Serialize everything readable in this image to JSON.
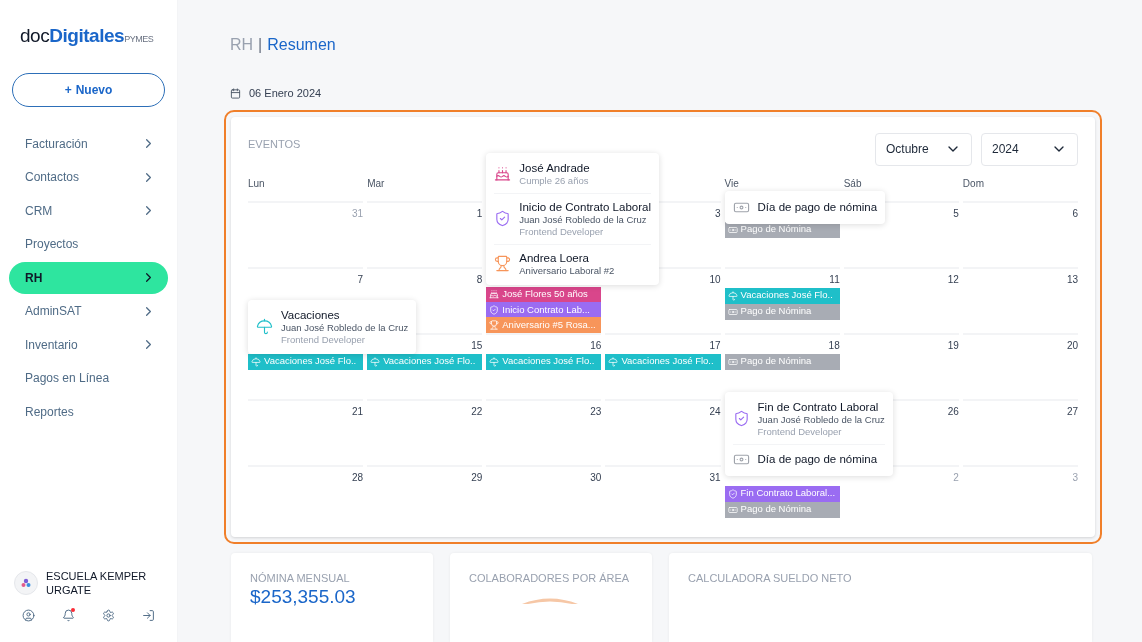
{
  "sidebar": {
    "logo": {
      "prefix": "doc",
      "name": "Digitales",
      "suffix": "PYMES"
    },
    "new_button": {
      "icon": "+",
      "label": "Nuevo"
    },
    "items": [
      {
        "label": "Facturación",
        "expandable": true,
        "selected": false
      },
      {
        "label": "Contactos",
        "expandable": true,
        "selected": false
      },
      {
        "label": "CRM",
        "expandable": true,
        "selected": false
      },
      {
        "label": "Proyectos",
        "expandable": false,
        "selected": false
      },
      {
        "label": "RH",
        "expandable": true,
        "selected": true
      },
      {
        "label": "AdminSAT",
        "expandable": true,
        "selected": false
      },
      {
        "label": "Inventario",
        "expandable": true,
        "selected": false
      },
      {
        "label": "Pagos en Línea",
        "expandable": false,
        "selected": false
      },
      {
        "label": "Reportes",
        "expandable": false,
        "selected": false
      }
    ],
    "company": {
      "name": "ESCUELA KEMPER URGATE"
    },
    "footer_icons": [
      {
        "kind": "user"
      },
      {
        "kind": "bell",
        "unread": true
      },
      {
        "kind": "settings"
      },
      {
        "kind": "logout"
      }
    ]
  },
  "breadcrumb": {
    "section": "RH",
    "separator": "|",
    "page": "Resumen"
  },
  "date": "06 Enero 2024",
  "events_card": {
    "title": "EVENTOS",
    "month_select": "Octubre",
    "year_select": "2024",
    "weekdays": [
      {
        "kind": "mon",
        "label": "Lun"
      },
      {
        "kind": "tue",
        "label": "Mar"
      },
      {
        "kind": "fri",
        "label": "Vie"
      },
      {
        "kind": "sat",
        "label": "Sáb"
      },
      {
        "kind": "sun",
        "label": "Dom"
      }
    ],
    "weeks": [
      [
        {
          "date": "31",
          "outside": true
        },
        {
          "date": "1",
          "outside": false
        },
        {
          "popover": [
            {
              "kind": "birthday",
              "title": "José Andrade",
              "detail": "Cumple 26 años"
            },
            {
              "kind": "contract",
              "title": "Inicio de Contrato Laboral",
              "subtitle": "Juan José Robledo de la Cruz",
              "detail": "Frontend Developer"
            },
            {
              "kind": "anniversary",
              "title": "Andrea Loera",
              "subtitle": "Aniversario Laboral #2"
            }
          ]
        },
        {
          "date": "3",
          "outside": false
        },
        {
          "events": [
            {
              "kind": "payroll",
              "label": "Pago de Nómina"
            }
          ],
          "popover": [
            {
              "kind": "payroll",
              "title": "Día de pago de nómina"
            }
          ]
        },
        {
          "date": "5",
          "outside": false
        },
        {
          "date": "6",
          "outside": false
        }
      ],
      [
        {
          "date": "7",
          "outside": false
        },
        {
          "date": "8",
          "outside": false
        },
        {
          "events": [
            {
              "kind": "birthday",
              "label": "José Flores 50 años"
            },
            {
              "kind": "contract",
              "label": "Inicio Contrato Lab..."
            },
            {
              "kind": "anniversary",
              "label": "Aniversario #5 Rosa..."
            }
          ]
        },
        {
          "date": "10",
          "outside": false
        },
        {
          "date": "11",
          "outside": false,
          "events": [
            {
              "kind": "vacation",
              "label": "Vacaciones José Flo.."
            },
            {
              "kind": "payroll",
              "label": "Pago de Nómina"
            }
          ]
        },
        {
          "date": "12",
          "outside": false
        },
        {
          "date": "13",
          "outside": false
        }
      ],
      [
        {
          "events": [
            {
              "kind": "vacation",
              "label": "Vacaciones José Flo.."
            }
          ],
          "popover": [
            {
              "kind": "vacation",
              "title": "Vacaciones",
              "subtitle": "Juan José Robledo de la Cruz",
              "detail": "Frontend Developer"
            }
          ]
        },
        {
          "date": "15",
          "outside": false,
          "events": [
            {
              "kind": "vacation",
              "label": "Vacaciones José Flo.."
            }
          ]
        },
        {
          "date": "16",
          "outside": false,
          "events": [
            {
              "kind": "vacation",
              "label": "Vacaciones José Flo.."
            }
          ]
        },
        {
          "date": "17",
          "outside": false,
          "events": [
            {
              "kind": "vacation",
              "label": "Vacaciones José Flo.."
            }
          ]
        },
        {
          "date": "18",
          "outside": false,
          "events": [
            {
              "kind": "payroll",
              "label": "Pago de Nómina"
            }
          ]
        },
        {
          "date": "19",
          "outside": false
        },
        {
          "date": "20",
          "outside": false
        }
      ],
      [
        {
          "date": "21",
          "outside": false
        },
        {
          "date": "22",
          "outside": false
        },
        {
          "date": "23",
          "outside": false
        },
        {
          "date": "24",
          "outside": false
        },
        {
          "popover": [
            {
              "kind": "contract",
              "title": "Fin de Contrato Laboral",
              "subtitle": "Juan José Robledo de la Cruz",
              "detail": "Frontend Developer"
            },
            {
              "kind": "payroll",
              "title": "Día de pago de nómina"
            }
          ]
        },
        {
          "date": "26",
          "outside": false
        },
        {
          "date": "27",
          "outside": false
        }
      ],
      [
        {
          "date": "28",
          "outside": false
        },
        {
          "date": "29",
          "outside": false
        },
        {
          "date": "30",
          "outside": false
        },
        {
          "date": "31",
          "outside": false
        },
        {
          "events": [
            {
              "kind": "contract",
              "label": "Fin Contrato Laboral..."
            },
            {
              "kind": "payroll",
              "label": "Pago de Nómina"
            }
          ]
        },
        {
          "date": "2",
          "outside": true
        },
        {
          "date": "3",
          "outside": true
        }
      ]
    ]
  },
  "summary_cards": [
    {
      "kind": "amount",
      "title": "NÓMINA MENSUAL",
      "value": "$253,355.03"
    },
    {
      "kind": "chart",
      "title": "COLABORADORES POR ÁREA"
    },
    {
      "kind": "plain",
      "title": "CALCULADORA SUELDO NETO"
    }
  ]
}
